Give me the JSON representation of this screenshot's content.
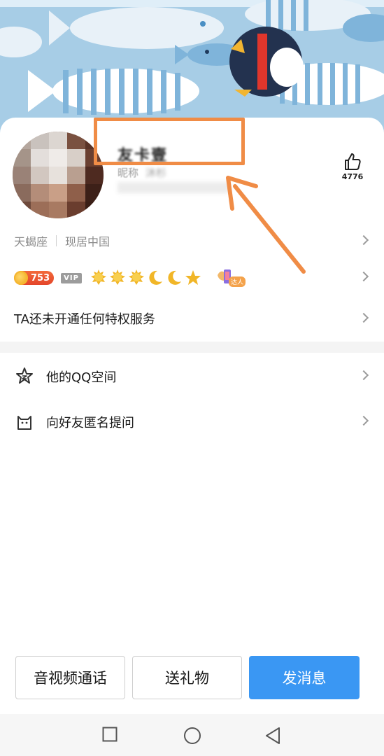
{
  "profile": {
    "display_name": "友卡壹",
    "nickname_label": "昵称",
    "nickname_value": "沐杉",
    "like_count": "4776"
  },
  "info": {
    "constellation": "天蝎座",
    "location": "现居中国"
  },
  "badges": {
    "level": "753",
    "vip": "VIP",
    "level_icons": [
      "sun-icon",
      "sun-icon",
      "sun-icon",
      "moon-icon",
      "moon-icon",
      "star-icon"
    ],
    "daren": "达人"
  },
  "privilege": {
    "text": "TA还未开通任何特权服务"
  },
  "menu": [
    {
      "label": "他的QQ空间",
      "icon": "qzone-star-icon"
    },
    {
      "label": "向好友匿名提问",
      "icon": "cat-icon"
    }
  ],
  "actions": {
    "call": "音视频通话",
    "gift": "送礼物",
    "message": "发消息"
  },
  "colors": {
    "primary": "#3a97f3",
    "highlight": "#f08c46",
    "level_badge": "#e4452a",
    "banner_bg": "#9cc6e2"
  },
  "navbar": [
    "square-icon",
    "circle-icon",
    "triangle-back-icon"
  ]
}
